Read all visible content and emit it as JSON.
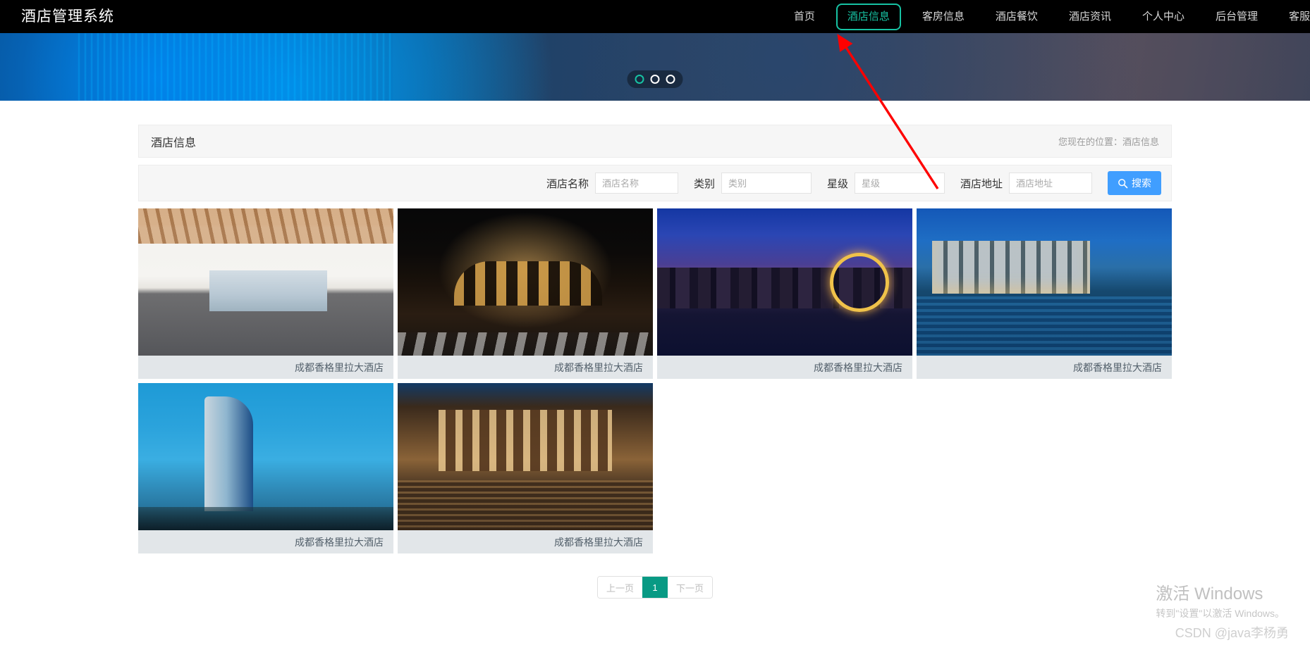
{
  "header": {
    "brand": "酒店管理系统",
    "nav_items": [
      {
        "label": "首页",
        "active": false
      },
      {
        "label": "酒店信息",
        "active": true
      },
      {
        "label": "客房信息",
        "active": false
      },
      {
        "label": "酒店餐饮",
        "active": false
      },
      {
        "label": "酒店资讯",
        "active": false
      },
      {
        "label": "个人中心",
        "active": false
      },
      {
        "label": "后台管理",
        "active": false
      },
      {
        "label": "客服",
        "active": false
      }
    ]
  },
  "banner": {
    "dots": [
      "dot-1",
      "dot-2",
      "dot-3"
    ],
    "active_dot_index": 0
  },
  "panel": {
    "title": "酒店信息",
    "breadcrumb": "您现在的位置：酒店信息"
  },
  "search": {
    "fields": [
      {
        "label": "酒店名称",
        "placeholder": "酒店名称",
        "value": ""
      },
      {
        "label": "类别",
        "placeholder": "类别",
        "value": ""
      },
      {
        "label": "星级",
        "placeholder": "星级",
        "value": ""
      },
      {
        "label": "酒店地址",
        "placeholder": "酒店地址",
        "value": ""
      }
    ],
    "button_label": "搜索",
    "button_icon": "search-icon",
    "button_color": "#409eff"
  },
  "cards": [
    {
      "caption": "成都香格里拉大酒店",
      "image": "hotel-interior-living-room"
    },
    {
      "caption": "成都香格里拉大酒店",
      "image": "hotel-night-facade"
    },
    {
      "caption": "成都香格里拉大酒店",
      "image": "city-skyline-ferris-wheel"
    },
    {
      "caption": "成都香格里拉大酒店",
      "image": "resort-pool-dusk"
    },
    {
      "caption": "成都香格里拉大酒店",
      "image": "blue-glass-tower"
    },
    {
      "caption": "成都香格里拉大酒店",
      "image": "traditional-courtyard"
    }
  ],
  "pagination": {
    "prev_label": "上一页",
    "next_label": "下一页",
    "pages": [
      "1"
    ],
    "current_page": "1",
    "active_color": "#089a84"
  },
  "watermark": {
    "windows_title": "激活 Windows",
    "windows_subtitle": "转到\"设置\"以激活 Windows。",
    "csdn": "CSDN @java李杨勇"
  },
  "colors": {
    "accent_teal": "#17c2a3",
    "primary_blue": "#409eff",
    "nav_bg": "#000000",
    "panel_bg": "#f6f6f6",
    "caption_bg": "#e2e6e9"
  }
}
